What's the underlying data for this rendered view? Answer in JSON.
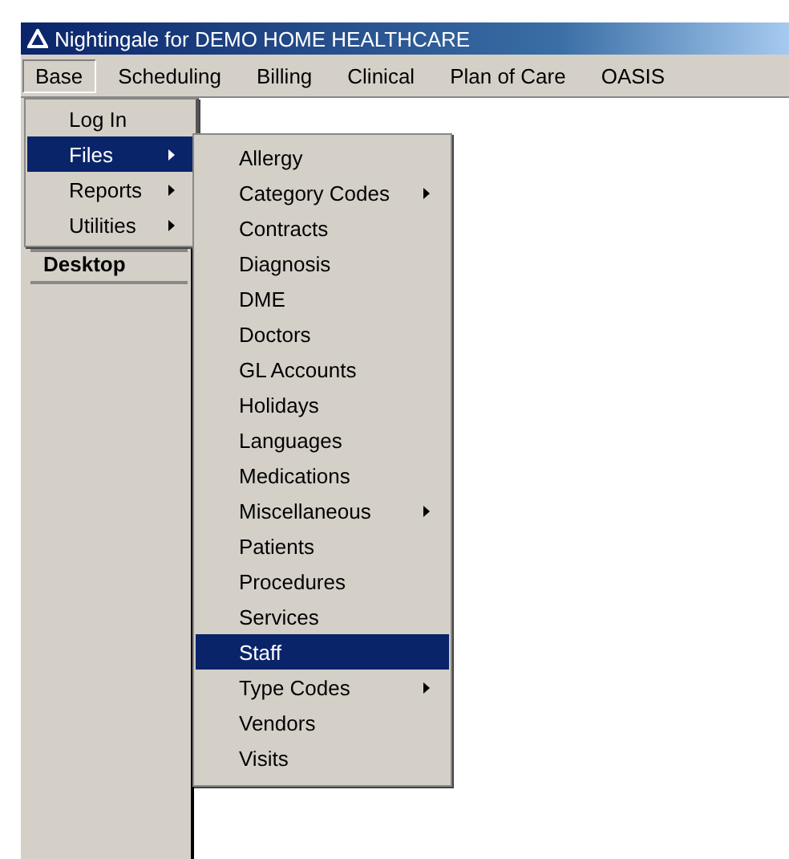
{
  "window": {
    "title": "Nightingale for DEMO HOME HEALTHCARE"
  },
  "menu_bar": [
    {
      "label": "Base",
      "selected": true
    },
    {
      "label": "Scheduling",
      "selected": false
    },
    {
      "label": "Billing",
      "selected": false
    },
    {
      "label": "Clinical",
      "selected": false
    },
    {
      "label": "Plan of Care",
      "selected": false
    },
    {
      "label": "OASIS",
      "selected": false
    }
  ],
  "base_menu": [
    {
      "label": "Log In",
      "selected": false,
      "submenu": false
    },
    {
      "label": "Files",
      "selected": true,
      "submenu": true
    },
    {
      "label": "Reports",
      "selected": false,
      "submenu": true
    },
    {
      "label": "Utilities",
      "selected": false,
      "submenu": true
    }
  ],
  "sidebar": {
    "tab": "Desktop"
  },
  "files_menu": [
    {
      "label": "Allergy",
      "selected": false,
      "submenu": false
    },
    {
      "label": "Category Codes",
      "selected": false,
      "submenu": true
    },
    {
      "label": "Contracts",
      "selected": false,
      "submenu": false
    },
    {
      "label": "Diagnosis",
      "selected": false,
      "submenu": false
    },
    {
      "label": "DME",
      "selected": false,
      "submenu": false
    },
    {
      "label": "Doctors",
      "selected": false,
      "submenu": false
    },
    {
      "label": "GL Accounts",
      "selected": false,
      "submenu": false
    },
    {
      "label": "Holidays",
      "selected": false,
      "submenu": false
    },
    {
      "label": "Languages",
      "selected": false,
      "submenu": false
    },
    {
      "label": "Medications",
      "selected": false,
      "submenu": false
    },
    {
      "label": "Miscellaneous",
      "selected": false,
      "submenu": true
    },
    {
      "label": "Patients",
      "selected": false,
      "submenu": false
    },
    {
      "label": "Procedures",
      "selected": false,
      "submenu": false
    },
    {
      "label": "Services",
      "selected": false,
      "submenu": false
    },
    {
      "label": "Staff",
      "selected": true,
      "submenu": false
    },
    {
      "label": "Type Codes",
      "selected": false,
      "submenu": true
    },
    {
      "label": "Vendors",
      "selected": false,
      "submenu": false
    },
    {
      "label": "Visits",
      "selected": false,
      "submenu": false
    }
  ]
}
